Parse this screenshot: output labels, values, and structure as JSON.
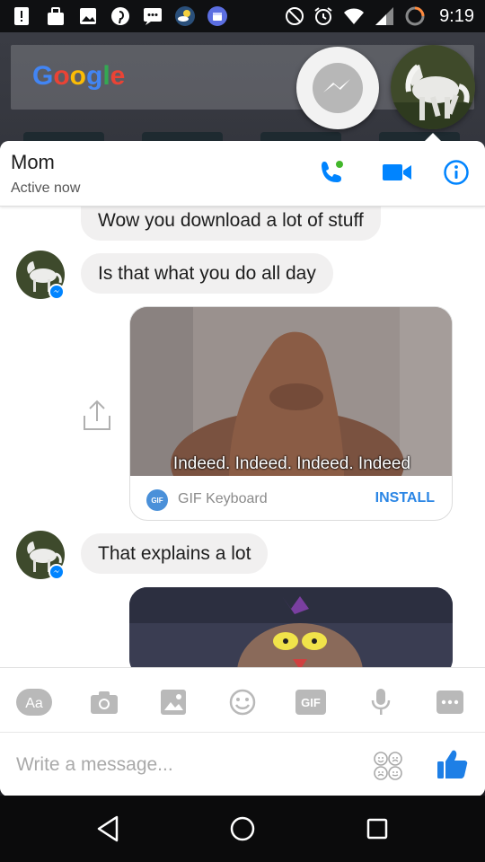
{
  "status_bar": {
    "time": "9:19",
    "icons": [
      "alert-icon",
      "bag-icon",
      "image-icon",
      "pinterest-icon",
      "message-icon",
      "weather-icon",
      "calendar-icon",
      "do-not-disturb-icon",
      "alarm-icon",
      "wifi-icon",
      "battery-icon"
    ]
  },
  "home": {
    "google_logo": "Google"
  },
  "header": {
    "contact_name": "Mom",
    "contact_status": "Active now"
  },
  "messages": [
    {
      "text": "Wow you download a lot of stuff",
      "from": "contact"
    },
    {
      "text": "Is that what you do all day",
      "from": "contact"
    },
    {
      "type": "gif",
      "caption": "Indeed. Indeed. Indeed. Indeed",
      "source": "GIF Keyboard",
      "action": "INSTALL"
    },
    {
      "text": "That explains a lot",
      "from": "contact"
    }
  ],
  "composer": {
    "placeholder": "Write a message..."
  },
  "toolbar": {
    "tools": [
      "text-icon",
      "camera-icon",
      "gallery-icon",
      "emoji-icon",
      "gif-icon",
      "microphone-icon",
      "more-icon"
    ],
    "gif_label": "GIF",
    "text_label": "Aa"
  },
  "colors": {
    "messenger_blue": "#0084ff",
    "bubble_gray": "#f1f0f0",
    "install_blue": "#2b86e5",
    "like_blue": "#1e7fe6"
  }
}
